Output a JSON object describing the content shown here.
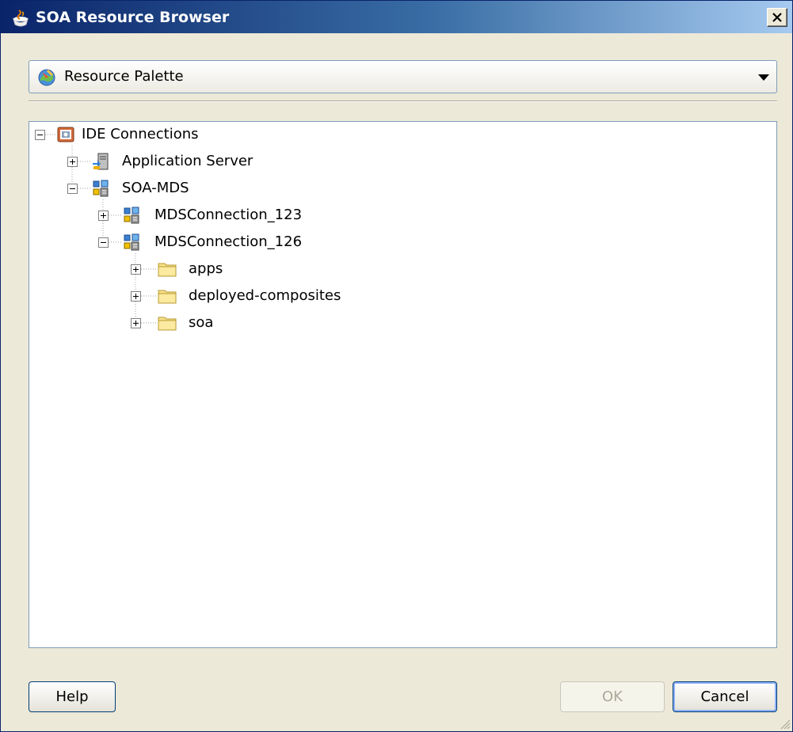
{
  "window": {
    "title": "SOA Resource Browser"
  },
  "palette": {
    "selected": "Resource Palette"
  },
  "tree": {
    "root": "IDE Connections",
    "application_server": "Application Server",
    "soa_mds": "SOA-MDS",
    "mds_123": "MDSConnection_123",
    "mds_126": "MDSConnection_126",
    "folders": [
      "apps",
      "deployed-composites",
      "soa"
    ]
  },
  "buttons": {
    "help": "Help",
    "ok": "OK",
    "cancel": "Cancel"
  }
}
